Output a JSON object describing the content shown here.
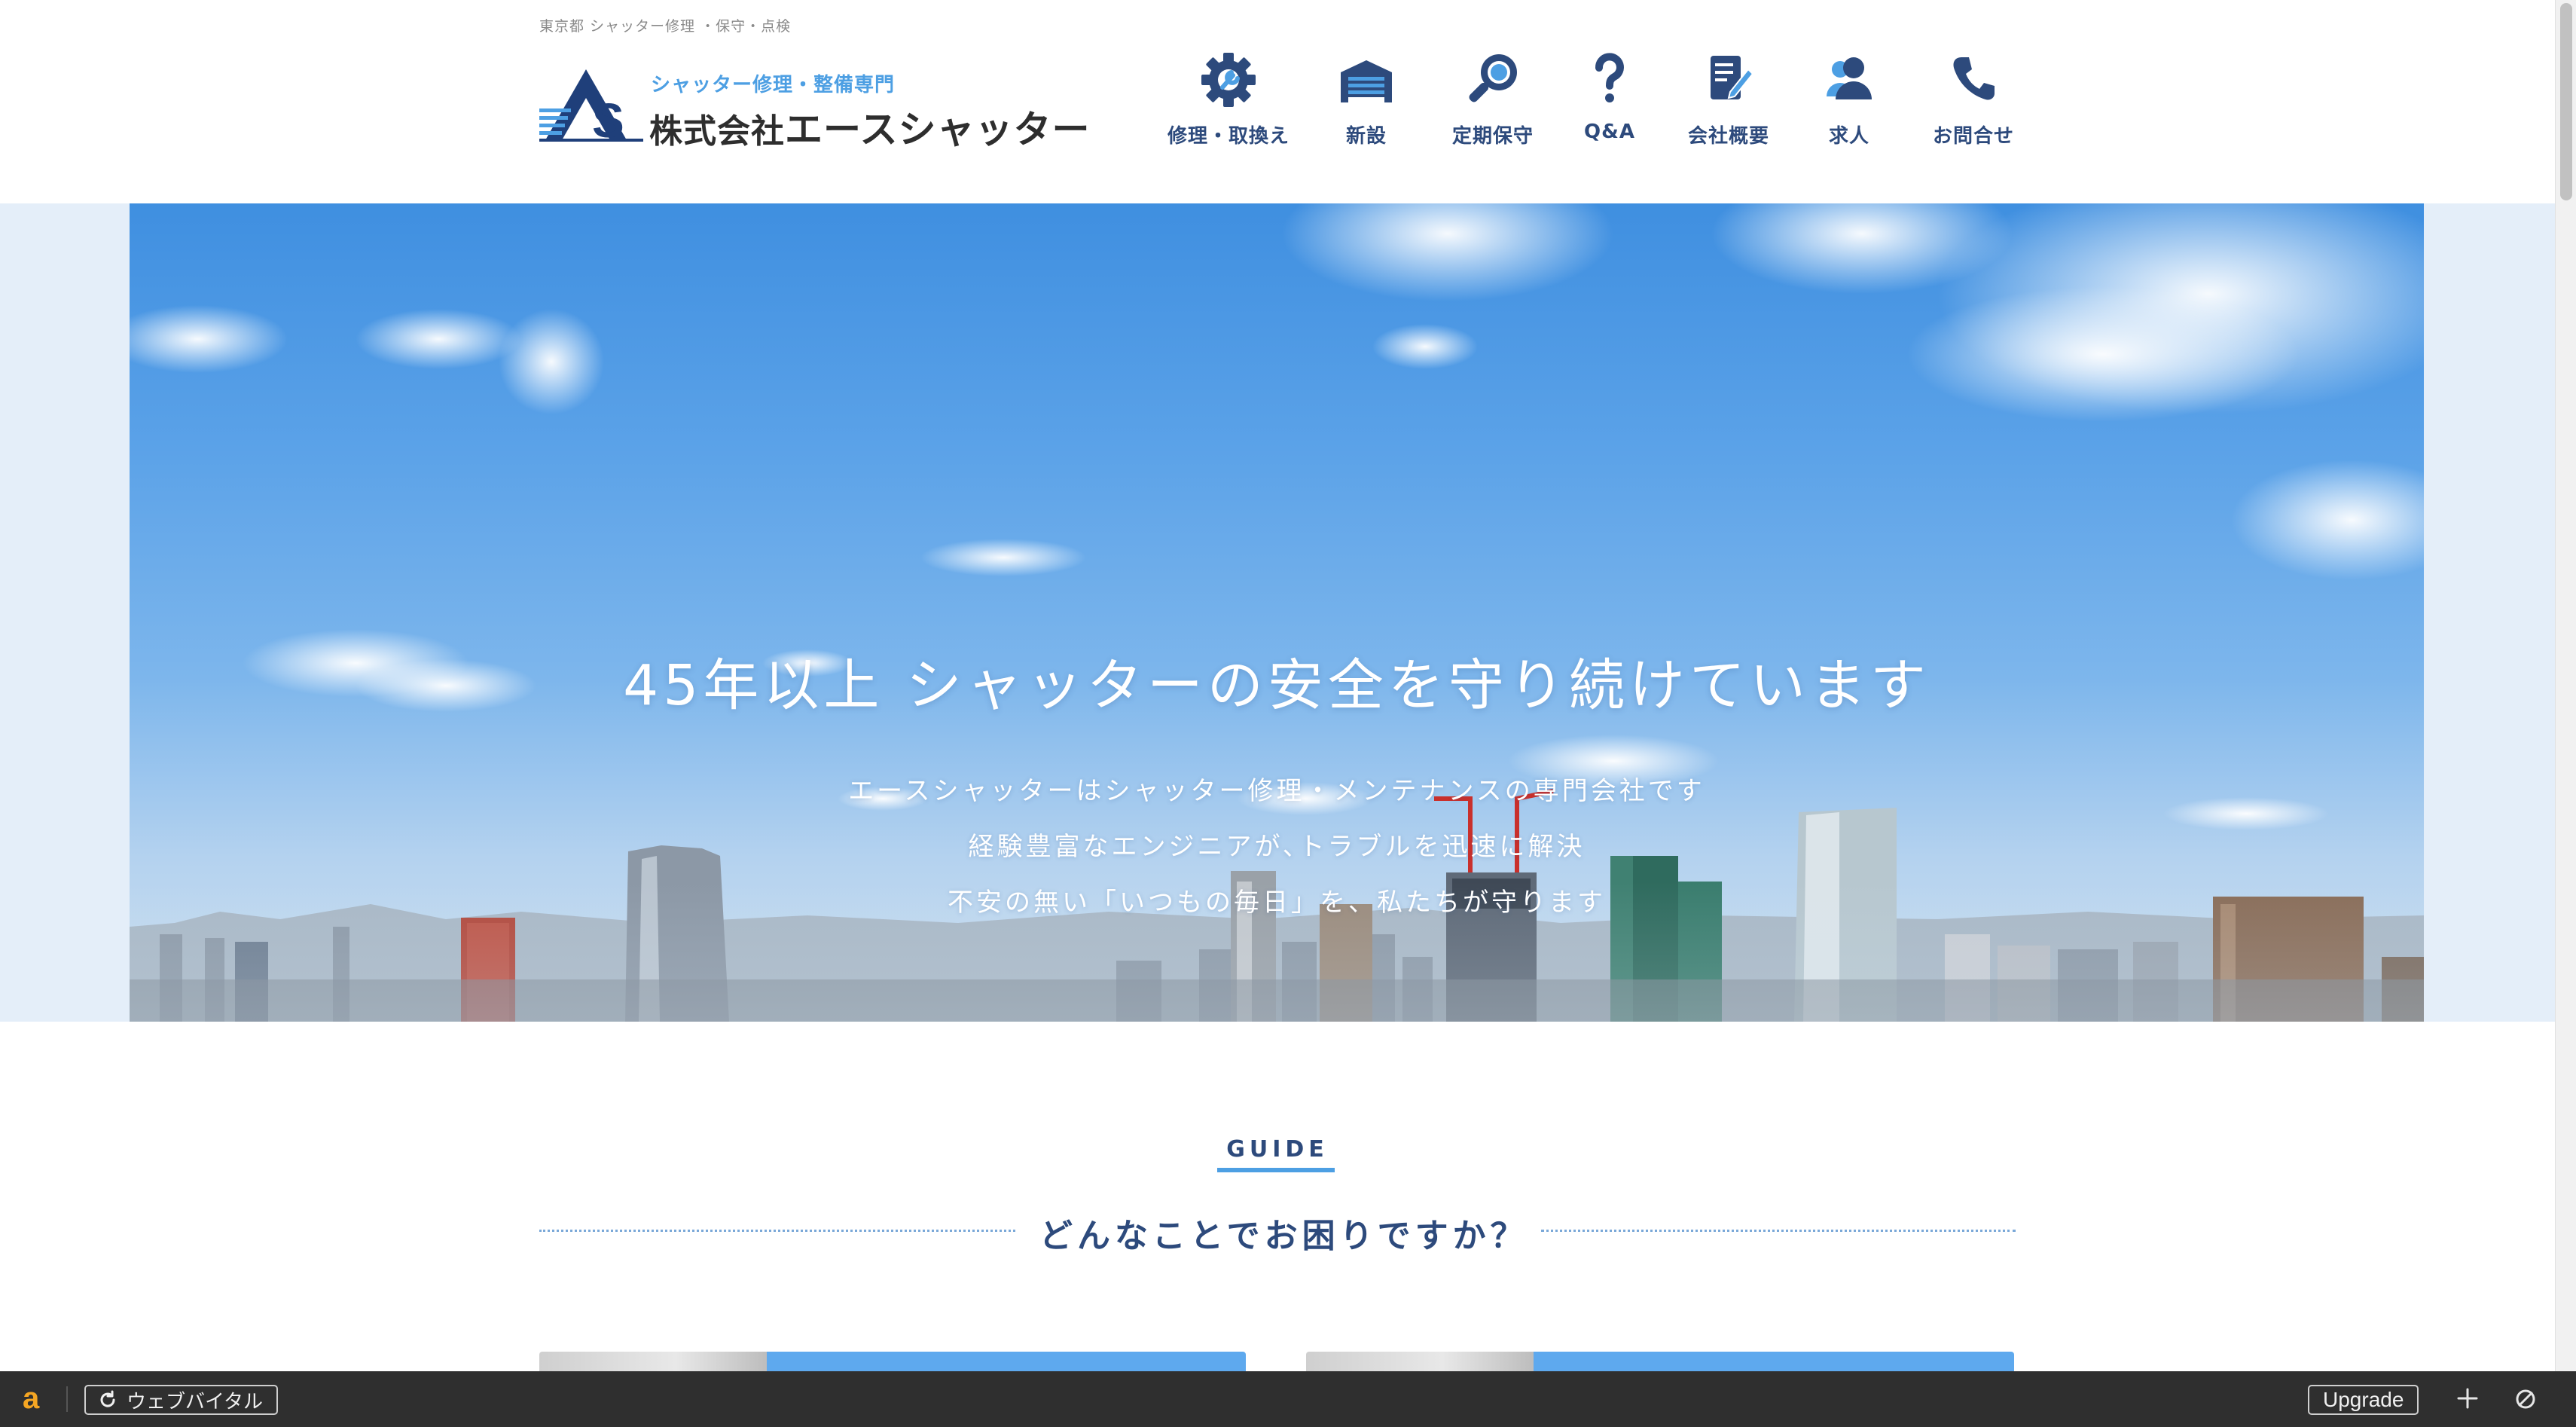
{
  "header": {
    "tagline": "東京都 シャッター修理 ・保守・点検",
    "logo_sub": "シャッター修理・整備専門",
    "logo_prefix": "株式会社",
    "logo_name": "エースシャッター"
  },
  "nav": {
    "items": [
      {
        "label": "修理・取換え",
        "icon": "gear-wrench-icon"
      },
      {
        "label": "新設",
        "icon": "garage-shutter-icon"
      },
      {
        "label": "定期保守",
        "icon": "magnifier-icon"
      },
      {
        "label": "Q&A",
        "icon": "question-icon"
      },
      {
        "label": "会社概要",
        "icon": "document-pen-icon"
      },
      {
        "label": "求人",
        "icon": "people-icon"
      },
      {
        "label": "お問合せ",
        "icon": "phone-icon"
      }
    ]
  },
  "hero": {
    "title": "45年以上 シャッターの安全を守り続けています",
    "line1": "エースシャッターはシャッター修理・メンテナンスの専門会社です",
    "line2": "経験豊富なエンジニアが､トラブルを迅速に解決",
    "line3": "不安の無い「いつもの毎日」を、私たちが守ります"
  },
  "guide": {
    "label": "GUIDE",
    "heading": "どんなことでお困りですか？"
  },
  "toolbar": {
    "logo_glyph": "a",
    "vitals_label": "ウェブバイタル",
    "upgrade_label": "Upgrade"
  },
  "colors": {
    "brand_blue": "#2d4a7c",
    "accent_blue": "#4d9fe3",
    "toolbar_bg": "#2f2f2f"
  }
}
